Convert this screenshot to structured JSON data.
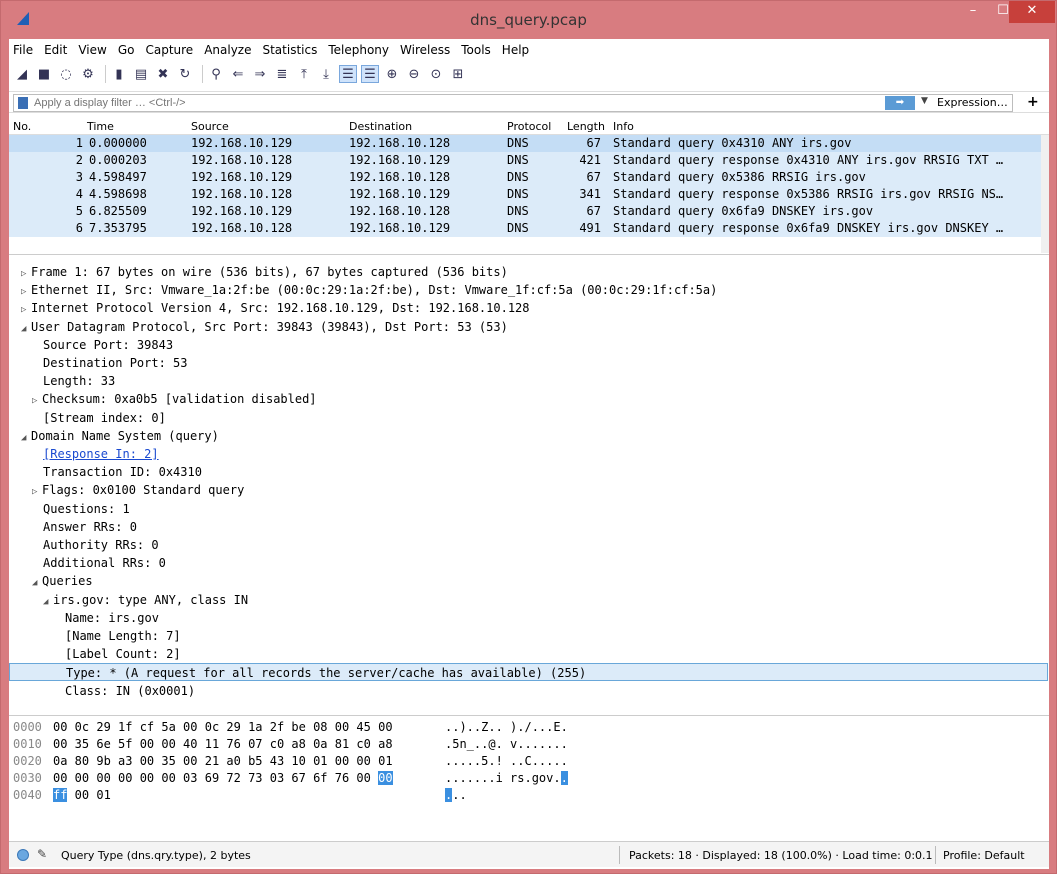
{
  "window": {
    "title": "dns_query.pcap"
  },
  "menu": [
    "File",
    "Edit",
    "View",
    "Go",
    "Capture",
    "Analyze",
    "Statistics",
    "Telephony",
    "Wireless",
    "Tools",
    "Help"
  ],
  "filter": {
    "placeholder": "Apply a display filter … <Ctrl-/>",
    "expression_label": "Expression…",
    "add_label": "+"
  },
  "packet_list": {
    "headers": {
      "no": "No.",
      "time": "Time",
      "source": "Source",
      "destination": "Destination",
      "protocol": "Protocol",
      "length": "Length",
      "info": "Info"
    },
    "rows": [
      {
        "no": "1",
        "time": "0.000000",
        "source": "192.168.10.129",
        "destination": "192.168.10.128",
        "protocol": "DNS",
        "length": "67",
        "info": "Standard query 0x4310 ANY irs.gov"
      },
      {
        "no": "2",
        "time": "0.000203",
        "source": "192.168.10.128",
        "destination": "192.168.10.129",
        "protocol": "DNS",
        "length": "421",
        "info": "Standard query response 0x4310 ANY irs.gov RRSIG TXT …"
      },
      {
        "no": "3",
        "time": "4.598497",
        "source": "192.168.10.129",
        "destination": "192.168.10.128",
        "protocol": "DNS",
        "length": "67",
        "info": "Standard query 0x5386 RRSIG irs.gov"
      },
      {
        "no": "4",
        "time": "4.598698",
        "source": "192.168.10.128",
        "destination": "192.168.10.129",
        "protocol": "DNS",
        "length": "341",
        "info": "Standard query response 0x5386 RRSIG irs.gov RRSIG NS…"
      },
      {
        "no": "5",
        "time": "6.825509",
        "source": "192.168.10.129",
        "destination": "192.168.10.128",
        "protocol": "DNS",
        "length": "67",
        "info": "Standard query 0x6fa9 DNSKEY irs.gov"
      },
      {
        "no": "6",
        "time": "7.353795",
        "source": "192.168.10.128",
        "destination": "192.168.10.129",
        "protocol": "DNS",
        "length": "491",
        "info": "Standard query response 0x6fa9 DNSKEY irs.gov DNSKEY …"
      }
    ]
  },
  "details": [
    {
      "text": "Frame 1: 67 bytes on wire (536 bits), 67 bytes captured (536 bits)",
      "tri": "▷"
    },
    {
      "text": "Ethernet II, Src: Vmware_1a:2f:be (00:0c:29:1a:2f:be), Dst: Vmware_1f:cf:5a (00:0c:29:1f:cf:5a)",
      "tri": "▷"
    },
    {
      "text": "Internet Protocol Version 4, Src: 192.168.10.129, Dst: 192.168.10.128",
      "tri": "▷"
    },
    {
      "text": "User Datagram Protocol, Src Port: 39843 (39843), Dst Port: 53 (53)",
      "tri": "◢"
    },
    {
      "text": "Source Port: 39843"
    },
    {
      "text": "Destination Port: 53"
    },
    {
      "text": "Length: 33"
    },
    {
      "text": "Checksum: 0xa0b5 [validation disabled]",
      "tri": "▷"
    },
    {
      "text": "[Stream index: 0]"
    },
    {
      "text": "Domain Name System (query)",
      "tri": "◢"
    },
    {
      "text": "[Response In: 2]"
    },
    {
      "text": "Transaction ID: 0x4310"
    },
    {
      "text": "Flags: 0x0100 Standard query",
      "tri": "▷"
    },
    {
      "text": "Questions: 1"
    },
    {
      "text": "Answer RRs: 0"
    },
    {
      "text": "Authority RRs: 0"
    },
    {
      "text": "Additional RRs: 0"
    },
    {
      "text": "Queries",
      "tri": "◢"
    },
    {
      "text": "irs.gov: type ANY, class IN",
      "tri": "◢"
    },
    {
      "text": "Name: irs.gov"
    },
    {
      "text": "[Name Length: 7]"
    },
    {
      "text": "[Label Count: 2]"
    },
    {
      "text": "Type: * (A request for all records the server/cache has available) (255)"
    },
    {
      "text": "Class: IN (0x0001)"
    }
  ],
  "hex": [
    {
      "offset": "0000",
      "bytes": "00 0c 29 1f cf 5a 00 0c  29 1a 2f be 08 00 45 00",
      "ascii": "..)..Z.. )./...E."
    },
    {
      "offset": "0010",
      "bytes": "00 35 6e 5f 00 00 40 11  76 07 c0 a8 0a 81 c0 a8",
      "ascii": ".5n_..@. v......."
    },
    {
      "offset": "0020",
      "bytes": "0a 80 9b a3 00 35 00 21  a0 b5 43 10 01 00 00 01",
      "ascii": ".....5.! ..C....."
    },
    {
      "offset": "0030",
      "bytes": "00 00 00 00 00 00 03 69  72 73 03 67 6f 76 00",
      "hl_bytes": "00",
      "ascii": ".......i rs.gov.",
      "hl_ascii": "."
    },
    {
      "offset": "0040",
      "hl_bytes": "ff",
      "bytes": " 00 01",
      "hl_ascii": ".",
      "ascii": ".."
    }
  ],
  "status": {
    "text": "Query Type (dns.qry.type), 2 bytes",
    "packets": "Packets: 18 · Displayed: 18 (100.0%) · Load time: 0:0.1",
    "profile": "Profile: Default"
  },
  "colors": {
    "title_bar": "#d87c80",
    "row_bg": "#dcebf9",
    "highlight": "#3a8fe0"
  }
}
